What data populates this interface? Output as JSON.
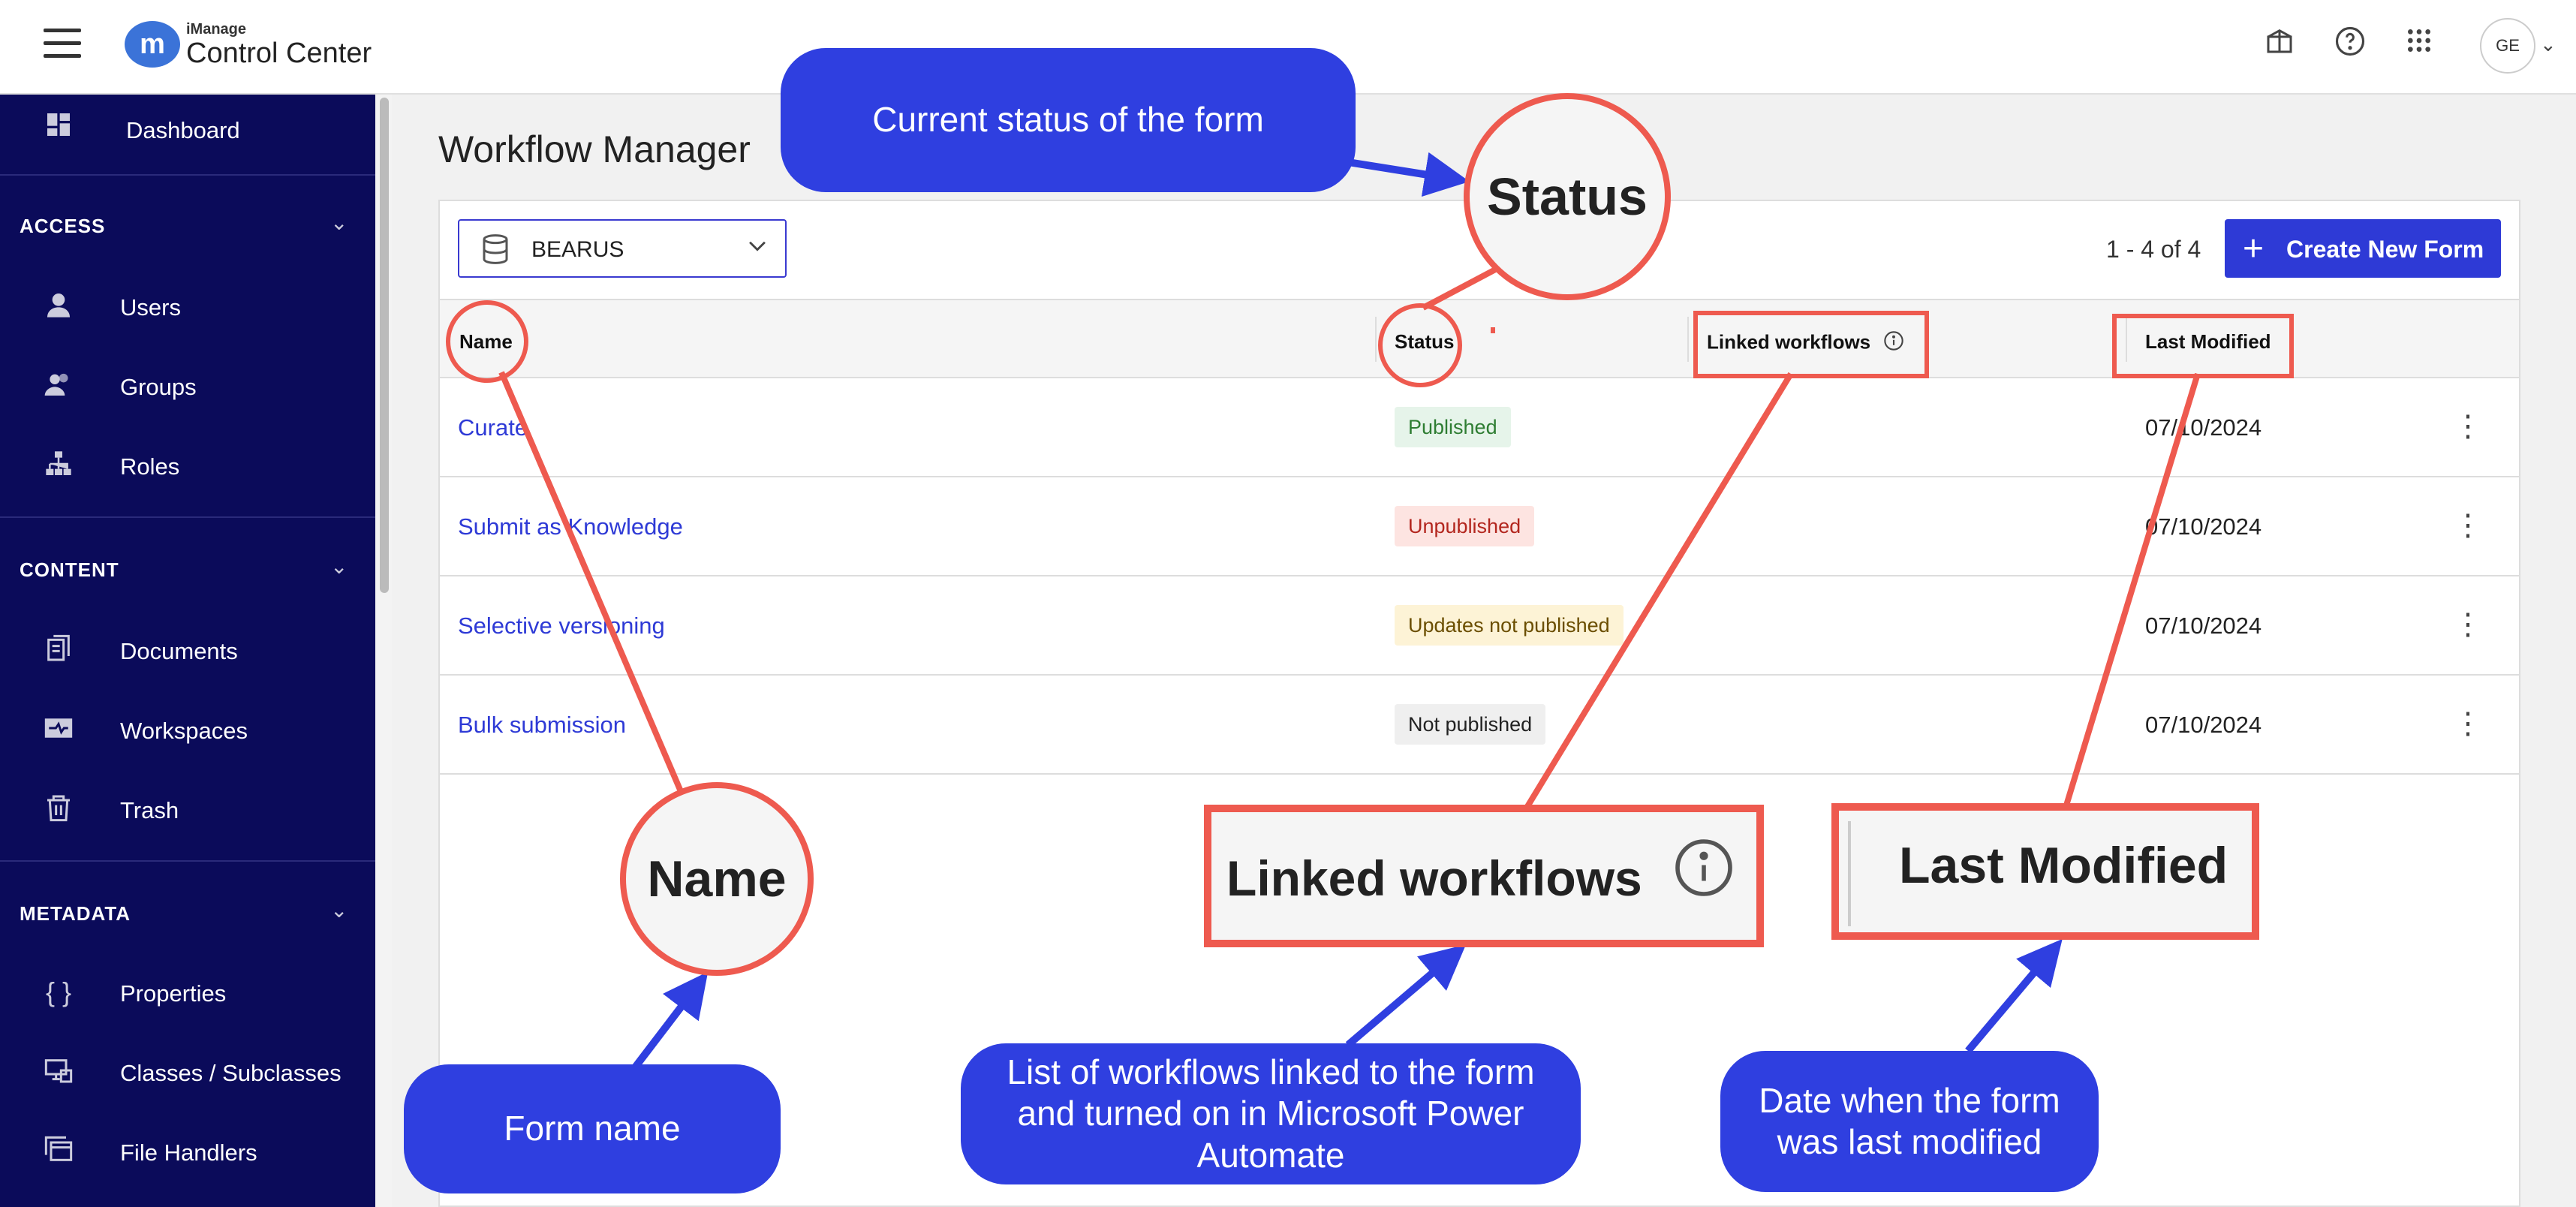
{
  "header": {
    "brand_small": "iManage",
    "brand_big": "Control Center",
    "logo_letter": "m",
    "avatar_initials": "GE"
  },
  "sidebar": {
    "dashboard": "Dashboard",
    "sections": [
      {
        "title": "ACCESS",
        "items": [
          "Users",
          "Groups",
          "Roles"
        ]
      },
      {
        "title": "CONTENT",
        "items": [
          "Documents",
          "Workspaces",
          "Trash"
        ]
      },
      {
        "title": "METADATA",
        "items": [
          "Properties",
          "Classes / Subclasses",
          "File Handlers"
        ]
      }
    ]
  },
  "main": {
    "title": "Workflow Manager",
    "repository": "BEARUS",
    "pager": "1 - 4 of 4",
    "create_button": "Create New Form",
    "columns": {
      "name": "Name",
      "status": "Status",
      "linked": "Linked workflows",
      "modified": "Last Modified"
    },
    "rows": [
      {
        "name": "Curate",
        "status": "Published",
        "date": "07/10/2024"
      },
      {
        "name": "Submit as Knowledge",
        "status": "Unpublished",
        "date": "07/10/2024"
      },
      {
        "name": "Selective versioning",
        "status": "Updates not published",
        "date": "07/10/2024"
      },
      {
        "name": "Bulk submission",
        "status": "Not published",
        "date": "07/10/2024"
      }
    ]
  },
  "status_colors": {
    "Published": {
      "bg": "#e6f4ea",
      "fg": "#2e7d32"
    },
    "Unpublished": {
      "bg": "#fde4e1",
      "fg": "#b3261e"
    },
    "Updates not published": {
      "bg": "#fdf3d6",
      "fg": "#6b4e00"
    },
    "Not published": {
      "bg": "#efefef",
      "fg": "#222222"
    }
  },
  "annotations": {
    "status_callout": "Current status of the form",
    "name_callout": "Form name",
    "linked_callout": "List of workflows linked to the form and turned on in Microsoft Power Automate",
    "modified_callout": "Date when the form was last modified",
    "zoom_status": "Status",
    "zoom_name": "Name",
    "zoom_linked": "Linked workflows",
    "zoom_modified": "Last Modified"
  },
  "colors": {
    "sidebar_bg": "#0b0b5a",
    "accent": "#2e3ad6",
    "annotation_red": "#ee5a4f",
    "callout_blue": "#2f3fe0"
  }
}
